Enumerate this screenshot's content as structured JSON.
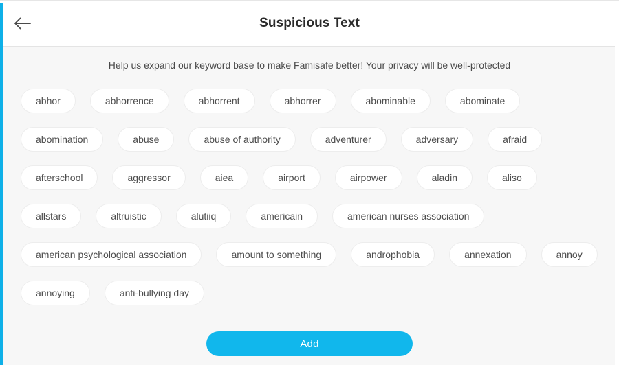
{
  "window": {
    "accent_color": "#0eb0e8"
  },
  "header": {
    "back_label": "Back",
    "title": "Suspicious Text"
  },
  "content": {
    "subtitle": "Help us expand our keyword base to make Famisafe better! Your privacy will be well-protected",
    "keywords": [
      "abhor",
      "abhorrence",
      "abhorrent",
      "abhorrer",
      "abominable",
      "abominate",
      "abomination",
      "abuse",
      "abuse of authority",
      "adventurer",
      "adversary",
      "afraid",
      "afterschool",
      "aggressor",
      "aiea",
      "airport",
      "airpower",
      "aladin",
      "aliso",
      "allstars",
      "altruistic",
      "alutiiq",
      "americain",
      "american nurses association",
      "american psychological association",
      "amount to something",
      "androphobia",
      "annexation",
      "annoy",
      "annoying",
      "anti-bullying day"
    ]
  },
  "footer": {
    "add_label": "Add",
    "add_color": "#11b7ec"
  }
}
